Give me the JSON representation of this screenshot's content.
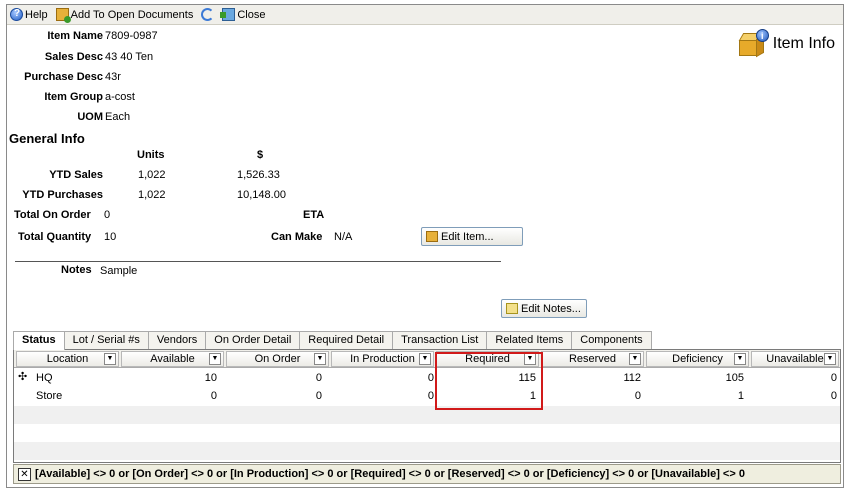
{
  "toolbar": {
    "help_label": "Help",
    "add_label": "Add To Open Documents",
    "close_label": "Close"
  },
  "header": {
    "title": "Item Info"
  },
  "item": {
    "name_label": "Item Name",
    "name_value": "7809-0987",
    "sales_desc_label": "Sales Desc",
    "sales_desc_value": "43 40 Ten",
    "purchase_desc_label": "Purchase Desc",
    "purchase_desc_value": "43r",
    "group_label": "Item Group",
    "group_value": "a-cost",
    "uom_label": "UOM",
    "uom_value": "Each"
  },
  "general": {
    "title": "General Info",
    "units_header": "Units",
    "dollar_header": "$",
    "ytd_sales_label": "YTD Sales",
    "ytd_sales_units": "1,022",
    "ytd_sales_dollars": "1,526.33",
    "ytd_purchases_label": "YTD Purchases",
    "ytd_purchases_units": "1,022",
    "ytd_purchases_dollars": "10,148.00",
    "total_on_order_label": "Total On Order",
    "total_on_order_value": "0",
    "eta_label": "ETA",
    "total_quantity_label": "Total Quantity",
    "total_quantity_value": "10",
    "can_make_label": "Can Make",
    "can_make_value": "N/A",
    "edit_item_button": "Edit Item...",
    "notes_label": "Notes",
    "notes_value": "Sample",
    "edit_notes_button": "Edit Notes..."
  },
  "tabs": [
    {
      "label": "Status"
    },
    {
      "label": "Lot / Serial #s"
    },
    {
      "label": "Vendors"
    },
    {
      "label": "On Order Detail"
    },
    {
      "label": "Required Detail"
    },
    {
      "label": "Transaction List"
    },
    {
      "label": "Related Items"
    },
    {
      "label": "Components"
    }
  ],
  "grid": {
    "columns": [
      "Location",
      "Available",
      "On Order",
      "In Production",
      "Required",
      "Reserved",
      "Deficiency",
      "Unavailable"
    ],
    "rows": [
      {
        "location": "HQ",
        "available": "10",
        "on_order": "0",
        "in_production": "0",
        "required": "115",
        "reserved": "112",
        "deficiency": "105",
        "unavailable": "0"
      },
      {
        "location": "Store",
        "available": "0",
        "on_order": "0",
        "in_production": "0",
        "required": "1",
        "reserved": "0",
        "deficiency": "1",
        "unavailable": "0"
      }
    ]
  },
  "filter": {
    "text": "[Available] <> 0 or [On Order] <> 0 or [In Production] <> 0 or [Required] <> 0 or [Reserved] <> 0 or [Deficiency] <> 0 or [Unavailable] <> 0"
  },
  "colors": {
    "highlight": "#d11a1a",
    "filter_bar": "#efeedf"
  }
}
